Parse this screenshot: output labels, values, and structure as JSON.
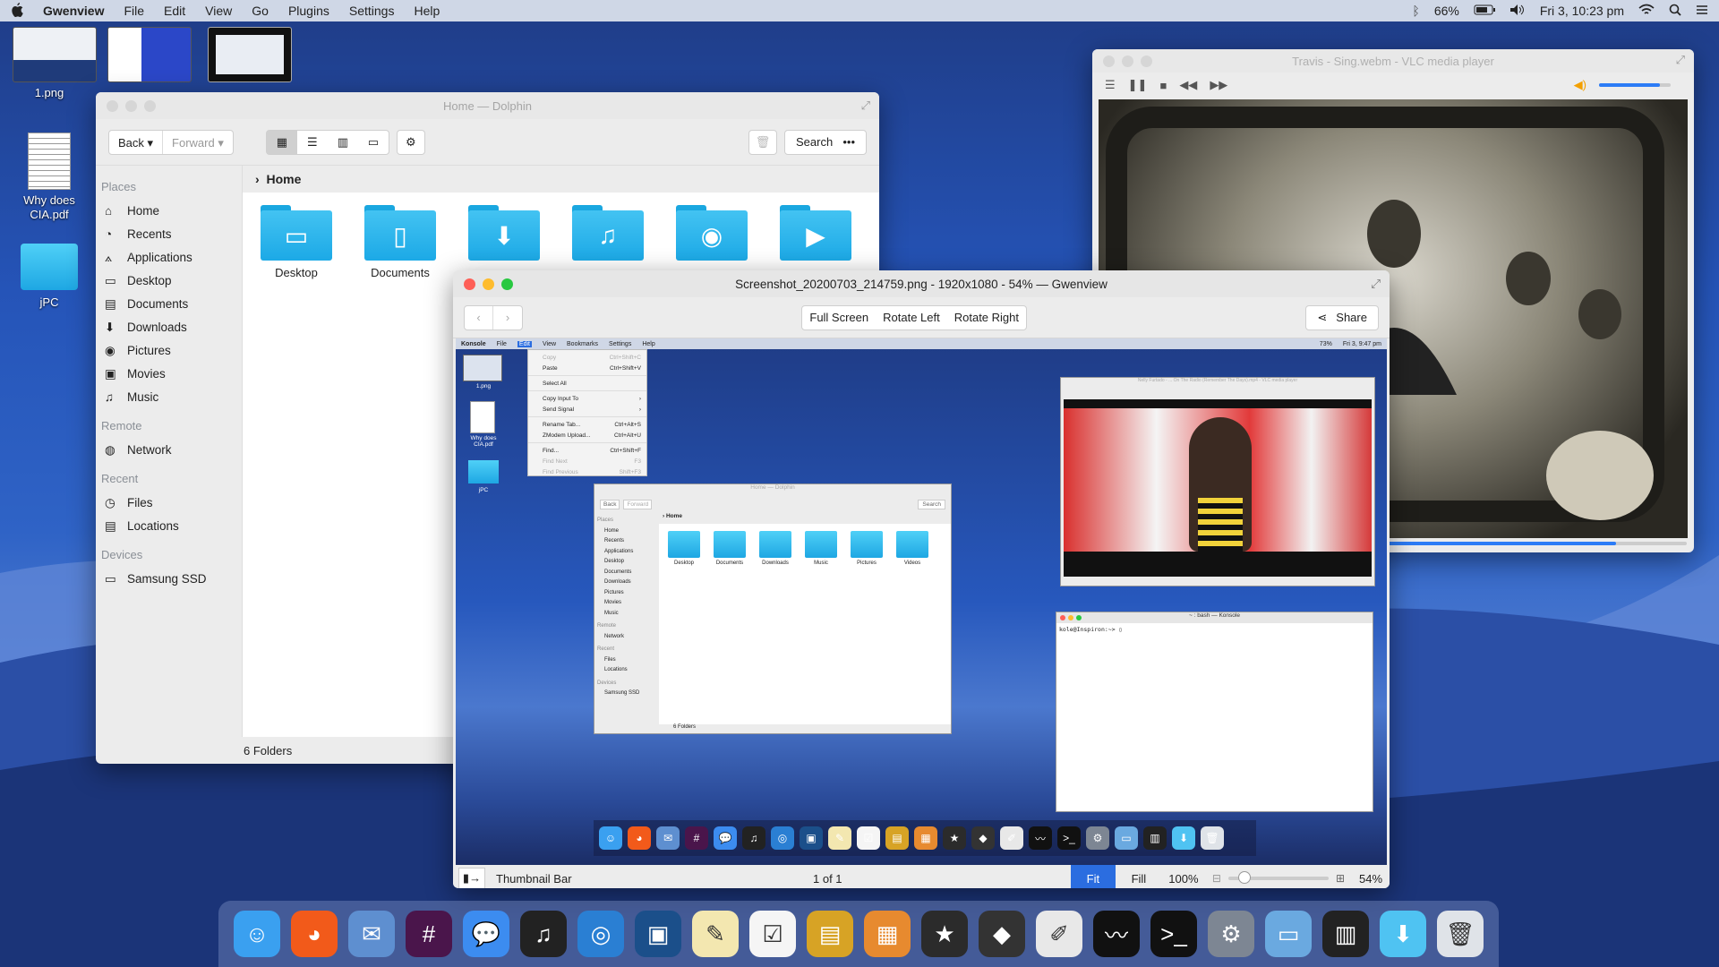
{
  "menubar": {
    "app": "Gwenview",
    "items": [
      "File",
      "Edit",
      "View",
      "Go",
      "Plugins",
      "Settings",
      "Help"
    ],
    "battery": "66%",
    "clock": "Fri 3, 10:23 pm"
  },
  "desktop": {
    "icons": [
      {
        "label": "1.png"
      },
      {
        "label": "Why does CIA.pdf"
      },
      {
        "label": "jPC"
      }
    ]
  },
  "dolphin": {
    "title": "Home — Dolphin",
    "back": "Back",
    "forward": "Forward",
    "search": "Search",
    "breadcrumb": "Home",
    "status": "6 Folders",
    "sections": {
      "places": "Places",
      "remote": "Remote",
      "recent": "Recent",
      "devices": "Devices"
    },
    "places": [
      "Home",
      "Recents",
      "Applications",
      "Desktop",
      "Documents",
      "Downloads",
      "Pictures",
      "Movies",
      "Music"
    ],
    "remote": [
      "Network"
    ],
    "recent": [
      "Files",
      "Locations"
    ],
    "devices": [
      "Samsung SSD"
    ],
    "folders": [
      "Desktop",
      "Documents",
      "Downloads",
      "Music",
      "Pictures",
      "Videos"
    ]
  },
  "vlc": {
    "title": "Travis - Sing.webm - VLC media player",
    "volume": 0.85,
    "progress": 0.88
  },
  "gwenview": {
    "title": "Screenshot_20200703_214759.png - 1920x1080 - 54% — Gwenview",
    "fullscreen": "Full Screen",
    "rotate_left": "Rotate Left",
    "rotate_right": "Rotate Right",
    "share": "Share",
    "thumbnail_bar": "Thumbnail Bar",
    "page_counter": "1 of 1",
    "fit": "Fit",
    "fill": "Fill",
    "zoom_100": "100%",
    "zoom_level": "54%",
    "zoom_slider": 0.1
  },
  "inner": {
    "menubar": {
      "app": "Konsole",
      "items": [
        "File",
        "Edit",
        "View",
        "Bookmarks",
        "Settings",
        "Help"
      ],
      "battery": "73%",
      "clock": "Fri 3, 9:47 pm"
    },
    "edit_menu": [
      {
        "label": "Copy",
        "shortcut": "Ctrl+Shift+C",
        "disabled": true
      },
      {
        "label": "Paste",
        "shortcut": "Ctrl+Shift+V",
        "disabled": false
      },
      {
        "label": "Select All",
        "shortcut": "",
        "disabled": false
      },
      {
        "label": "Copy Input To",
        "shortcut": "›",
        "disabled": false
      },
      {
        "label": "Send Signal",
        "shortcut": "›",
        "disabled": false
      },
      {
        "label": "Rename Tab...",
        "shortcut": "Ctrl+Alt+S",
        "disabled": false
      },
      {
        "label": "ZModem Upload...",
        "shortcut": "Ctrl+Alt+U",
        "disabled": false
      },
      {
        "label": "Find...",
        "shortcut": "Ctrl+Shift+F",
        "disabled": false
      },
      {
        "label": "Find Next",
        "shortcut": "F3",
        "disabled": true
      },
      {
        "label": "Find Previous",
        "shortcut": "Shift+F3",
        "disabled": true
      }
    ],
    "vlc_title": "Nelly Furtado - ... On The Radio (Remember The Days).mp4 - VLC media player",
    "konsole_title": "~ : bash — Konsole",
    "konsole_prompt": "kole@Inspiron:~> ",
    "dolphin_title": "Home — Dolphin",
    "back": "Back",
    "forward": "Forward",
    "search": "Search",
    "breadcrumb": "Home",
    "status": "6 Folders",
    "sections": {
      "places": "Places",
      "remote": "Remote",
      "recent": "Recent",
      "devices": "Devices"
    },
    "places": [
      "Home",
      "Recents",
      "Applications",
      "Desktop",
      "Documents",
      "Downloads",
      "Pictures",
      "Movies",
      "Music"
    ],
    "remote": [
      "Network"
    ],
    "recent": [
      "Files",
      "Locations"
    ],
    "devices": [
      "Samsung SSD"
    ],
    "folders": [
      "Desktop",
      "Documents",
      "Downloads",
      "Music",
      "Pictures",
      "Videos"
    ],
    "desktop_icons": [
      "1.png",
      "Why does CIA.pdf",
      "jPC"
    ]
  },
  "dock": {
    "items": [
      "finder",
      "firefox",
      "mail",
      "slack",
      "messages",
      "music",
      "browser",
      "monitor",
      "notes",
      "reminders",
      "presentation",
      "calculator",
      "imovie",
      "alfred",
      "drawing",
      "system-monitor",
      "terminal",
      "settings",
      "image-capture",
      "kde-apps",
      "downloads",
      "trash"
    ]
  }
}
